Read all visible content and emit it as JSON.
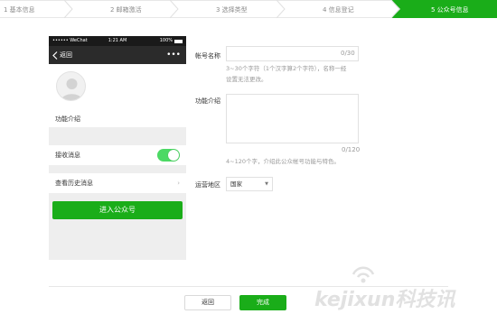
{
  "steps": [
    {
      "label": "1 基本信息"
    },
    {
      "label": "2 邮箱激活"
    },
    {
      "label": "3 选择类型"
    },
    {
      "label": "4 信息登记"
    },
    {
      "label": "5 公众号信息"
    }
  ],
  "phone": {
    "carrier": "•••••• WeChat",
    "time": "1:21 AM",
    "battery": "100%",
    "back_label": "返回",
    "more_label": "•••",
    "intro_label": "功能介绍",
    "receive_label": "接收消息",
    "receive_toggle_on": true,
    "history_label": "查看历史消息",
    "history_chevron": "›",
    "enter_button": "进入公众号"
  },
  "form": {
    "name_label": "帐号名称",
    "name_value": "",
    "name_counter": "0/30",
    "name_hint_line1": "3~30个字符（1个汉字算2个字符），名称一经",
    "name_hint_line2": "设置无法更改。",
    "intro_label": "功能介绍",
    "intro_value": "",
    "intro_counter": "0/120",
    "intro_hint": "4~120个字，介绍此公众帐号功能与特色。",
    "region_label": "运营地区",
    "region_value": "国家"
  },
  "footer": {
    "back_button": "返回",
    "done_button": "完成"
  },
  "watermark": {
    "text": "kejixun科技讯"
  },
  "colors": {
    "accent": "#1aad19",
    "toggle_on": "#4cd964",
    "nav_bg": "#2b2b2b"
  }
}
